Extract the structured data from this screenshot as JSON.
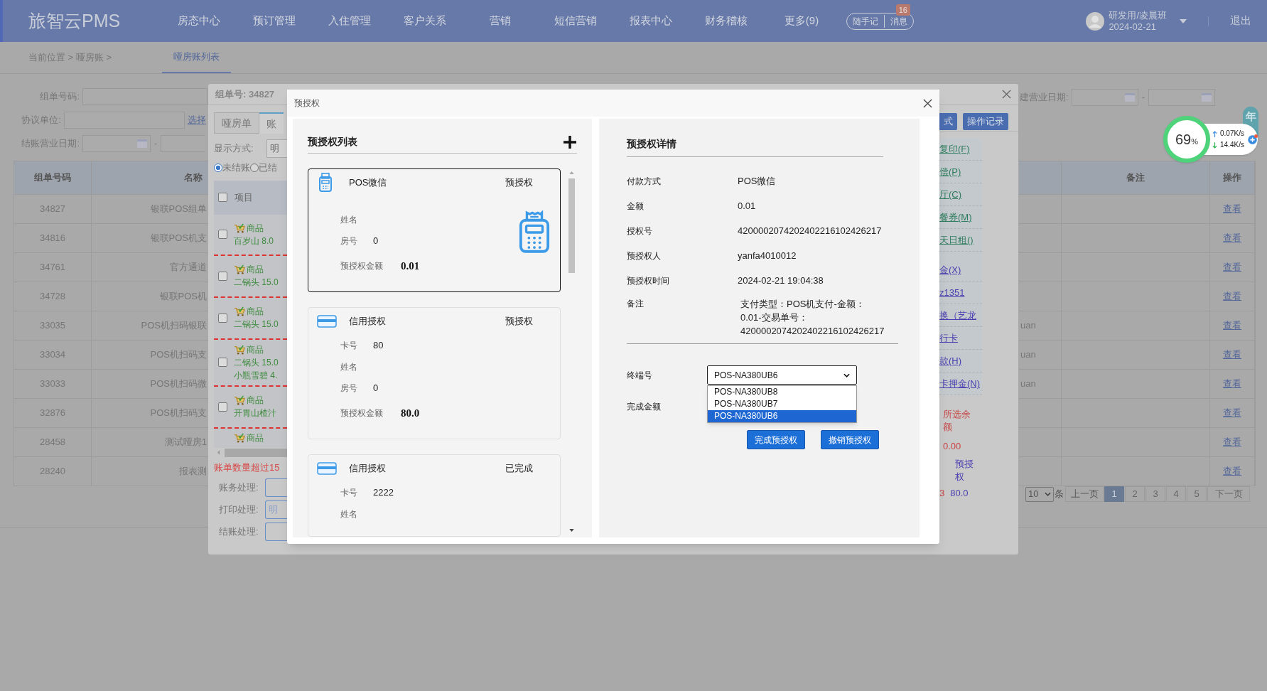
{
  "header": {
    "logo": "旅智云PMS",
    "nav": [
      "房态中心",
      "预订管理",
      "入住管理",
      "客户关系",
      "营销",
      "短信营销",
      "报表中心",
      "财务稽核",
      "更多(9)"
    ],
    "quick_buttons": [
      "随手记",
      "消息"
    ],
    "message_badge": "16",
    "user": {
      "name": "研发用/凌晨班",
      "date": "2024-02-21"
    },
    "logout": "退出"
  },
  "breadcrumb": {
    "path": "当前位置 > 哑房账 >",
    "tab": "哑房账列表"
  },
  "filters": {
    "group_no_label": "组单号码:",
    "agreement_label": "协议单位:",
    "agreement_link": "选择",
    "checkout_date_label": "结账营业日期:",
    "date_separator": "-",
    "create_date_label": "建营业日期:",
    "create_date_separator": "-"
  },
  "table": {
    "columns": [
      "组单号码",
      "名称",
      "备注",
      "操作"
    ],
    "rows": [
      {
        "id": "34827",
        "name": "银联POS组单",
        "action": "查看"
      },
      {
        "id": "34816",
        "name": "银联POS机支",
        "action": "查看"
      },
      {
        "id": "34761",
        "name": "官方通道",
        "action": "查看"
      },
      {
        "id": "34728",
        "name": "银联POS机",
        "action": "查看"
      },
      {
        "id": "33035",
        "name": "POS机扫码银联",
        "column_3": "uan",
        "action": "查看"
      },
      {
        "id": "33034",
        "name": "POS机扫码支",
        "column_3": "uan",
        "action": "查看"
      },
      {
        "id": "33033",
        "name": "POS机扫码微",
        "column_3": "uan",
        "action": "查看"
      },
      {
        "id": "32876",
        "name": "POS机扫码支",
        "action": "查看"
      },
      {
        "id": "28458",
        "name": "测试哑房1",
        "action": "查看"
      },
      {
        "id": "28240",
        "name": "报表测",
        "action": "查看"
      }
    ]
  },
  "pagination": {
    "page_size": "10",
    "unit": "条",
    "prev": "上一页",
    "pages": [
      {
        "label": "1",
        "selected": true
      },
      {
        "label": "2",
        "selected": false
      },
      {
        "label": "3",
        "selected": false
      },
      {
        "label": "4",
        "selected": false
      },
      {
        "label": "5",
        "selected": false
      }
    ],
    "next": "下一页"
  },
  "side_tab": "年",
  "speed_widget": {
    "percent": "69",
    "percent_sign": "%",
    "up": "0.07K/s",
    "down": "14.4K/s"
  },
  "group_modal": {
    "title": "组单号: 34827",
    "tabs": [
      {
        "label": "哑房单",
        "selected": false
      },
      {
        "label": "账",
        "selected": true
      }
    ],
    "display_label": "显示方式:",
    "display_value": "明",
    "radios": [
      {
        "label": "未结账",
        "selected": true
      },
      {
        "label": "已结",
        "selected": false
      }
    ],
    "header_checked": false,
    "items_header": "项目",
    "items": [
      {
        "category": "商品",
        "lines": [
          "百岁山 8.0"
        ],
        "checked": false
      },
      {
        "category": "商品",
        "lines": [
          "二锅头 15.0"
        ],
        "checked": false
      },
      {
        "category": "商品",
        "lines": [
          "二锅头 15.0"
        ],
        "checked": false
      },
      {
        "category": "商品",
        "lines": [
          "二锅头 15.0",
          "小瓶雪碧 4."
        ],
        "checked": false
      },
      {
        "category": "商品",
        "lines": [
          "开胃山楂汁"
        ],
        "checked": false
      },
      {
        "category": "商品"
      }
    ],
    "warning": "账单数量超过15",
    "actions": [
      {
        "label": "账务处理:"
      },
      {
        "label": "打印处理:",
        "value": "明"
      },
      {
        "label": "结账处理:"
      }
    ],
    "buttons": [
      "式",
      "操作记录"
    ],
    "links": [
      {
        "label": "复印(F)",
        "color": "#2f7d5e"
      },
      {
        "label": "偿(P)",
        "color": "#2f7d5e"
      },
      {
        "label": "厅(C)",
        "color": "#2f7d5e"
      },
      {
        "label": "餐券(M)",
        "color": "#2f7d5e"
      },
      {
        "label": "天日租()",
        "color": "#2f7d5e"
      },
      {
        "label": "金(X)",
        "color": "#4a3fb0"
      },
      {
        "label": "z1351",
        "color": "#4a3fb0"
      },
      {
        "label": "换（艺龙",
        "color": "#4a3fb0"
      },
      {
        "label": "行卡",
        "color": "#4a3fb0"
      },
      {
        "label": "款(H)",
        "color": "#4a3fb0"
      },
      {
        "label": "卡押金(N)",
        "color": "#4a3fb0"
      }
    ],
    "balance_label": "所选余额",
    "balance": "0.00",
    "preauth_label": "预授权",
    "preauth_fragment": "3",
    "preauth_amount": "80.0"
  },
  "preauth_modal": {
    "title": "预授权",
    "list_title": "预授权列表",
    "cards": [
      {
        "kind": "pos",
        "method": "POS微信",
        "status": "预授权",
        "selected": true,
        "fields": [
          {
            "label": "姓名"
          },
          {
            "label": "房号",
            "value": "0"
          }
        ],
        "amount_label": "预授权金额",
        "amount": "0.01"
      },
      {
        "kind": "card",
        "method": "信用授权",
        "status": "预授权",
        "selected": false,
        "fields": [
          {
            "label": "卡号",
            "value": "80"
          },
          {
            "label": "姓名"
          },
          {
            "label": "房号",
            "value": "0"
          }
        ],
        "amount_label": "预授权金额",
        "amount": "80.0"
      },
      {
        "kind": "card",
        "method": "信用授权",
        "status": "已完成",
        "selected": false,
        "fields": [
          {
            "label": "卡号",
            "value": "2222"
          },
          {
            "label": "姓名"
          }
        ]
      }
    ],
    "detail_title": "预授权详情",
    "details": [
      {
        "label": "付款方式",
        "value": "POS微信"
      },
      {
        "label": "金额",
        "value": "0.01"
      },
      {
        "label": "授权号",
        "value": "4200002074202402216102426217"
      },
      {
        "label": "预授权人",
        "value": "yanfa4010012"
      },
      {
        "label": "预授权时间",
        "value": "2024-02-21 19:04:38"
      },
      {
        "label": "备注",
        "value": "支付类型：POS机支付-金额：0.01-交易单号：4200002074202402216102426217"
      }
    ],
    "terminal": {
      "label": "终端号",
      "value": "POS-NA380UB6",
      "expanded": true,
      "options": [
        {
          "label": "POS-NA380UB8",
          "selected": false
        },
        {
          "label": "POS-NA380UB7",
          "selected": false
        },
        {
          "label": "POS-NA380UB6",
          "selected": true
        }
      ]
    },
    "complete_amount_label": "完成金额",
    "buttons": [
      "完成预授权",
      "撤销预授权"
    ]
  }
}
